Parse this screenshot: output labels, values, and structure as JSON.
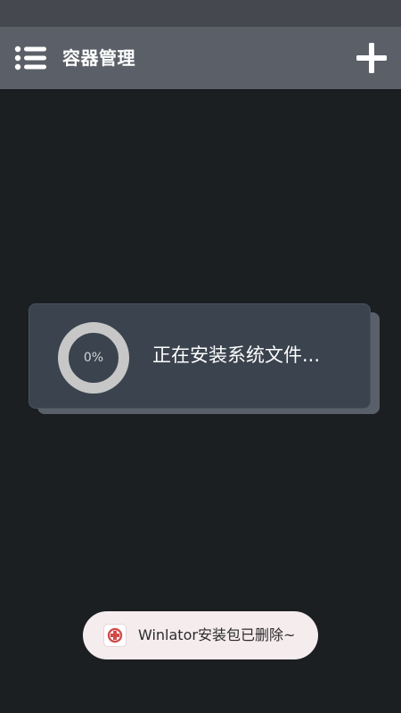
{
  "app_bar": {
    "title": "容器管理",
    "menu_icon": "list-menu-icon",
    "add_icon": "plus-icon",
    "background": "#5b6068"
  },
  "dialog": {
    "progress": {
      "label": "0%",
      "fraction": 0
    },
    "message": "正在安装系统文件..."
  },
  "toast": {
    "icon": "app-icon",
    "message": "Winlator安装包已删除~"
  },
  "colors": {
    "background": "#1c1f22",
    "dialog": "#3a434e",
    "toast": "#f5ecee"
  }
}
